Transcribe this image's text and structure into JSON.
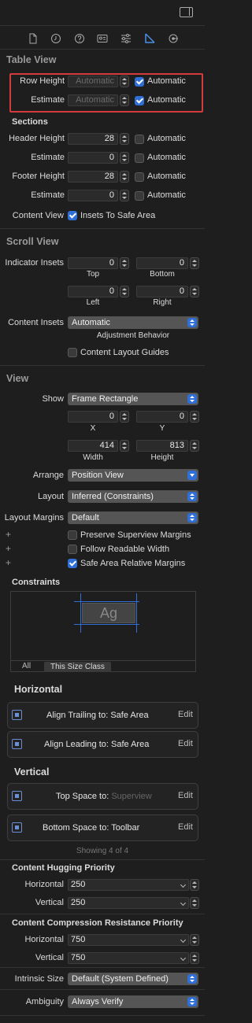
{
  "colors": {
    "accent": "#2f6fd6",
    "background": "#1e1e1e",
    "highlight_box": "#d43b3b"
  },
  "toolbar": {
    "icons": [
      "file-icon",
      "history-icon",
      "help-icon",
      "identity-icon",
      "attributes-icon",
      "size-icon",
      "connections-icon"
    ],
    "selected": "size-icon",
    "sidebar_toggle": "sidebar-toggle-icon"
  },
  "table_view": {
    "title": "Table View",
    "row_height": {
      "label": "Row Height",
      "value": "Automatic",
      "check_label": "Automatic",
      "checked": true
    },
    "estimate": {
      "label": "Estimate",
      "value": "Automatic",
      "check_label": "Automatic",
      "checked": true
    },
    "sections": {
      "title": "Sections",
      "header_height": {
        "label": "Header Height",
        "value": "28",
        "check_label": "Automatic",
        "checked": false
      },
      "header_estimate": {
        "label": "Estimate",
        "value": "0",
        "check_label": "Automatic",
        "checked": false
      },
      "footer_height": {
        "label": "Footer Height",
        "value": "28",
        "check_label": "Automatic",
        "checked": false
      },
      "footer_estimate": {
        "label": "Estimate",
        "value": "0",
        "check_label": "Automatic",
        "checked": false
      }
    },
    "content_view": {
      "label": "Content View",
      "check_label": "Insets To Safe Area",
      "checked": true
    }
  },
  "scroll_view": {
    "title": "Scroll View",
    "indicator_insets": {
      "label": "Indicator Insets",
      "top": "0",
      "bottom": "0",
      "left": "0",
      "right": "0",
      "top_label": "Top",
      "bottom_label": "Bottom",
      "left_label": "Left",
      "right_label": "Right"
    },
    "content_insets": {
      "label": "Content Insets",
      "value": "Automatic",
      "caption": "Adjustment Behavior"
    },
    "layout_guides": {
      "check_label": "Content Layout Guides",
      "checked": false
    }
  },
  "view": {
    "title": "View",
    "show": {
      "label": "Show",
      "value": "Frame Rectangle"
    },
    "x": "0",
    "y": "0",
    "x_label": "X",
    "y_label": "Y",
    "width": "414",
    "height": "813",
    "width_label": "Width",
    "height_label": "Height",
    "arrange": {
      "label": "Arrange",
      "value": "Position View"
    },
    "layout": {
      "label": "Layout",
      "value": "Inferred (Constraints)"
    },
    "layout_margins": {
      "label": "Layout Margins",
      "value": "Default"
    },
    "preserve": {
      "check_label": "Preserve Superview Margins",
      "checked": false
    },
    "readable": {
      "check_label": "Follow Readable Width",
      "checked": false
    },
    "safe_area": {
      "check_label": "Safe Area Relative Margins",
      "checked": true
    },
    "plus": "+"
  },
  "constraints": {
    "title": "Constraints",
    "preview_text": "Ag",
    "tabs": [
      {
        "label": "All",
        "selected": false
      },
      {
        "label": "This Size Class",
        "selected": true
      }
    ],
    "horizontal_title": "Horizontal",
    "horizontal": [
      {
        "label": "Align Trailing to:",
        "target": "Safe Area",
        "edit": "Edit"
      },
      {
        "label": "Align Leading to:",
        "target": "Safe Area",
        "edit": "Edit"
      }
    ],
    "vertical_title": "Vertical",
    "vertical": [
      {
        "label": "Top Space to:",
        "target": "Superview",
        "edit": "Edit"
      },
      {
        "label": "Bottom Space to:",
        "target": "Toolbar",
        "edit": "Edit"
      }
    ],
    "showing": "Showing 4 of 4"
  },
  "content_hugging": {
    "title": "Content Hugging Priority",
    "horizontal": {
      "label": "Horizontal",
      "value": "250"
    },
    "vertical": {
      "label": "Vertical",
      "value": "250"
    }
  },
  "compression": {
    "title": "Content Compression Resistance Priority",
    "horizontal": {
      "label": "Horizontal",
      "value": "750"
    },
    "vertical": {
      "label": "Vertical",
      "value": "750"
    }
  },
  "intrinsic_size": {
    "label": "Intrinsic Size",
    "value": "Default (System Defined)"
  },
  "ambiguity": {
    "label": "Ambiguity",
    "value": "Always Verify"
  }
}
